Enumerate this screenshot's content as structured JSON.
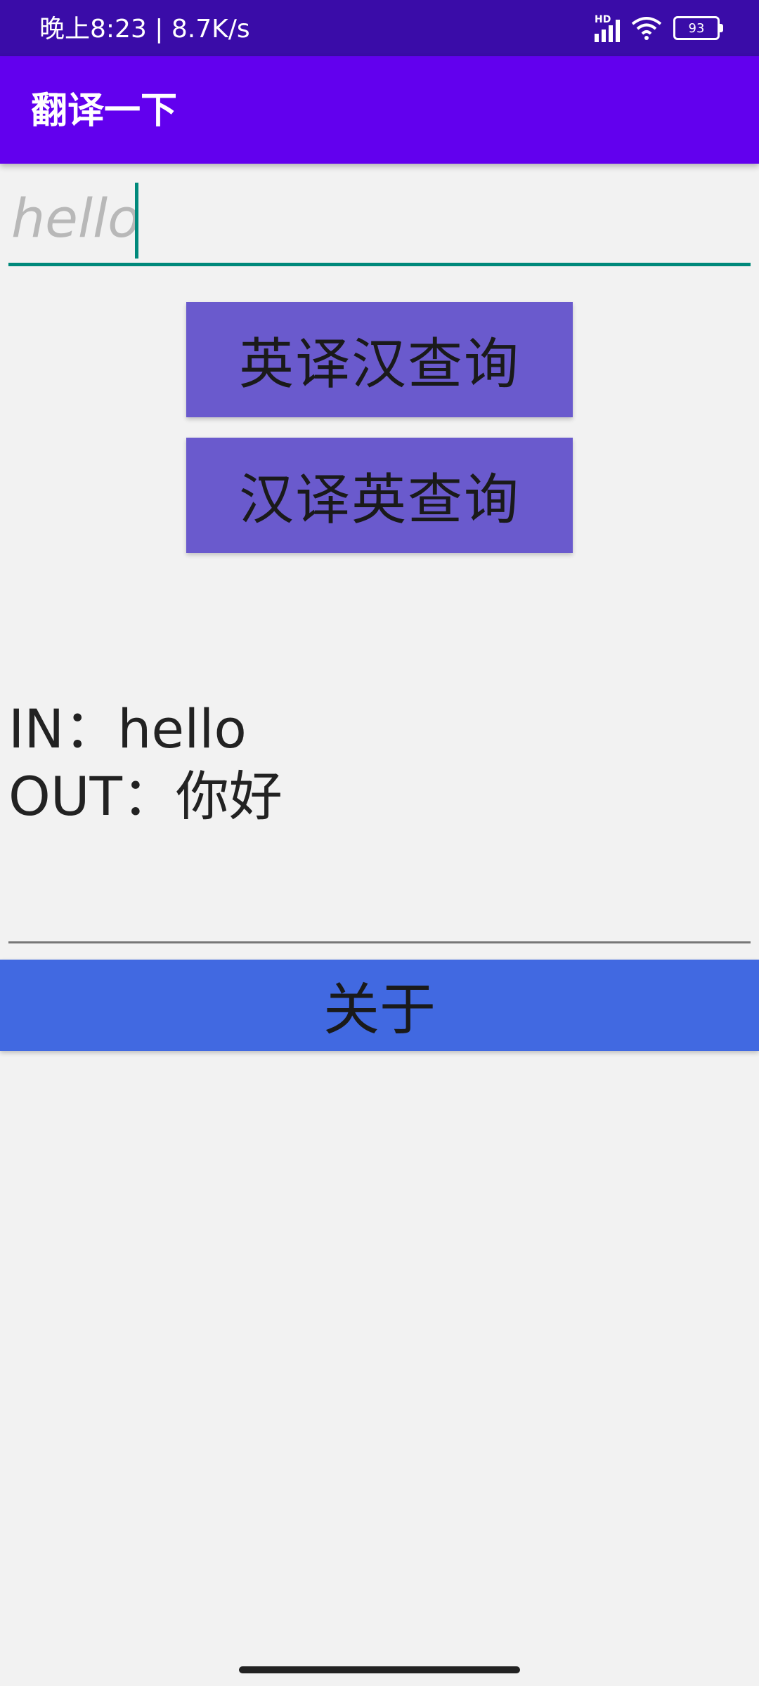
{
  "status_bar": {
    "text": "晚上8:23 | 8.7K/s",
    "signal_label": "HD",
    "battery_level": "93"
  },
  "app_bar": {
    "title": "翻译一下"
  },
  "input": {
    "placeholder": "hello"
  },
  "buttons": {
    "en_to_zh": "英译汉查询",
    "zh_to_en": "汉译英查询",
    "about": "关于"
  },
  "result": {
    "in_line": "IN：hello",
    "out_line": "OUT：你好"
  },
  "colors": {
    "status_bar": "#3a0ca8",
    "app_bar": "#6200ee",
    "accent": "#00897b",
    "query_button": "#6a5acd",
    "about_button": "#4169e1",
    "background": "#f2f2f2"
  },
  "icons": [
    "signal-icon",
    "wifi-icon",
    "battery-icon"
  ]
}
